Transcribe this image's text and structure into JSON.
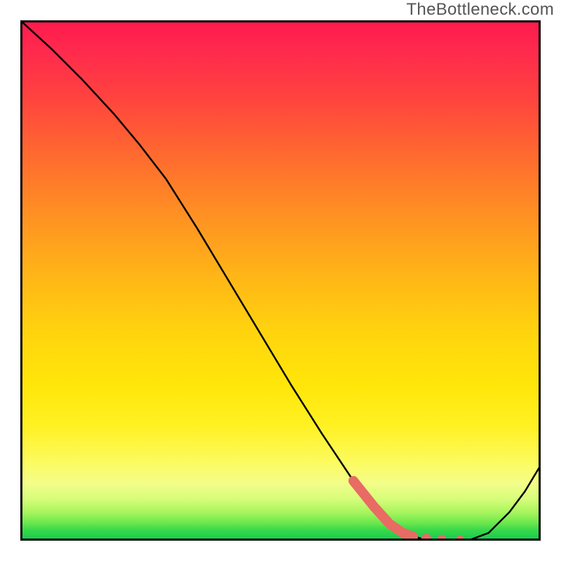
{
  "watermark": "TheBottleneck.com",
  "chart_data": {
    "type": "line",
    "title": "",
    "xlabel": "",
    "ylabel": "",
    "xlim": [
      0.0,
      1.0
    ],
    "ylim": [
      0.0,
      1.0
    ],
    "grid": false,
    "legend": false,
    "annotations": [
      "TheBottleneck.com"
    ],
    "series": [
      {
        "name": "bottleneck-curve",
        "color": "#000000",
        "x": [
          0.0,
          0.06,
          0.12,
          0.18,
          0.23,
          0.28,
          0.34,
          0.4,
          0.46,
          0.52,
          0.58,
          0.64,
          0.68,
          0.715,
          0.745,
          0.77,
          0.8,
          0.83,
          0.86,
          0.9,
          0.94,
          0.97,
          1.0
        ],
        "y": [
          1.0,
          0.945,
          0.885,
          0.82,
          0.76,
          0.695,
          0.6,
          0.5,
          0.4,
          0.3,
          0.205,
          0.115,
          0.065,
          0.03,
          0.012,
          0.004,
          0.0,
          0.0,
          0.0,
          0.015,
          0.055,
          0.095,
          0.145
        ]
      },
      {
        "name": "highlight-segment",
        "color": "#e86b64",
        "style": "thick",
        "x": [
          0.64,
          0.68,
          0.71,
          0.735,
          0.755
        ],
        "y": [
          0.115,
          0.065,
          0.032,
          0.015,
          0.008
        ]
      },
      {
        "name": "highlight-dots",
        "color": "#e86b64",
        "style": "dots",
        "x": [
          0.78,
          0.81,
          0.845
        ],
        "y": [
          0.004,
          0.003,
          0.003
        ]
      }
    ]
  }
}
